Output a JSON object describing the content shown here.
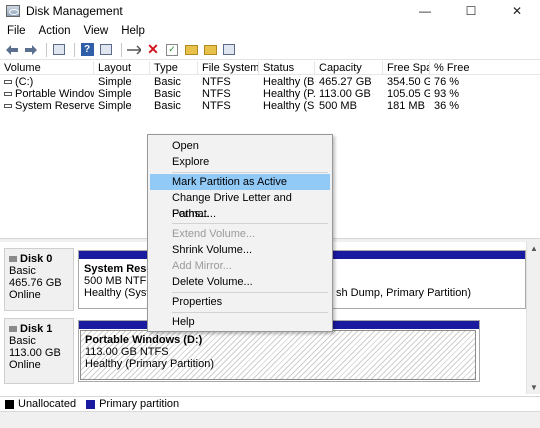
{
  "window": {
    "title": "Disk Management",
    "controls": {
      "minimize": "—",
      "maximize": "☐",
      "close": "✕"
    }
  },
  "menubar": [
    "File",
    "Action",
    "View",
    "Help"
  ],
  "toolbar_icons": [
    "back-icon",
    "forward-icon",
    "console-tree-icon",
    "help-icon",
    "properties-icon",
    "connect-icon",
    "delete-icon",
    "check-icon",
    "new-folder-icon",
    "explore-icon",
    "refresh-icon"
  ],
  "volume_table": {
    "columns": [
      "Volume",
      "Layout",
      "Type",
      "File System",
      "Status",
      "Capacity",
      "Free Spa...",
      "% Free"
    ],
    "rows": [
      [
        "(C:)",
        "Simple",
        "Basic",
        "NTFS",
        "Healthy (B...",
        "465.27 GB",
        "354.50 GB",
        "76 %"
      ],
      [
        "Portable Windows...",
        "Simple",
        "Basic",
        "NTFS",
        "Healthy (P...",
        "113.00 GB",
        "105.05 GB",
        "93 %"
      ],
      [
        "System Reserved",
        "Simple",
        "Basic",
        "NTFS",
        "Healthy (S...",
        "500 MB",
        "181 MB",
        "36 %"
      ]
    ]
  },
  "disks": [
    {
      "name": "Disk 0",
      "type": "Basic",
      "size": "465.76 GB",
      "status": "Online",
      "partitions": [
        {
          "name": "System Reserve",
          "detail": "500 MB NTFS",
          "status": "Healthy (System,"
        },
        {
          "name": "",
          "detail": "",
          "status": "sh Dump, Primary Partition)"
        }
      ]
    },
    {
      "name": "Disk 1",
      "type": "Basic",
      "size": "113.00 GB",
      "status": "Online",
      "partitions": [
        {
          "name": "Portable Windows  (D:)",
          "detail": "113.00 GB NTFS",
          "status": "Healthy (Primary Partition)"
        }
      ]
    }
  ],
  "legend": [
    {
      "label": "Unallocated",
      "color": "#000000"
    },
    {
      "label": "Primary partition",
      "color": "#1a1aa0"
    }
  ],
  "context_menu": {
    "items": [
      {
        "label": "Open",
        "enabled": true
      },
      {
        "label": "Explore",
        "enabled": true
      },
      {
        "label": "Mark Partition as Active",
        "enabled": true,
        "highlighted": true
      },
      {
        "label": "Change Drive Letter and Paths...",
        "enabled": true
      },
      {
        "label": "Format...",
        "enabled": true
      },
      {
        "label": "Extend Volume...",
        "enabled": false
      },
      {
        "label": "Shrink Volume...",
        "enabled": true
      },
      {
        "label": "Add Mirror...",
        "enabled": false
      },
      {
        "label": "Delete Volume...",
        "enabled": true
      },
      {
        "label": "Properties",
        "enabled": true
      },
      {
        "label": "Help",
        "enabled": true
      }
    ]
  },
  "colors": {
    "primary_partition": "#1a1aa0",
    "menu_highlight": "#91c9f7",
    "delete_icon": "#d0131c"
  }
}
